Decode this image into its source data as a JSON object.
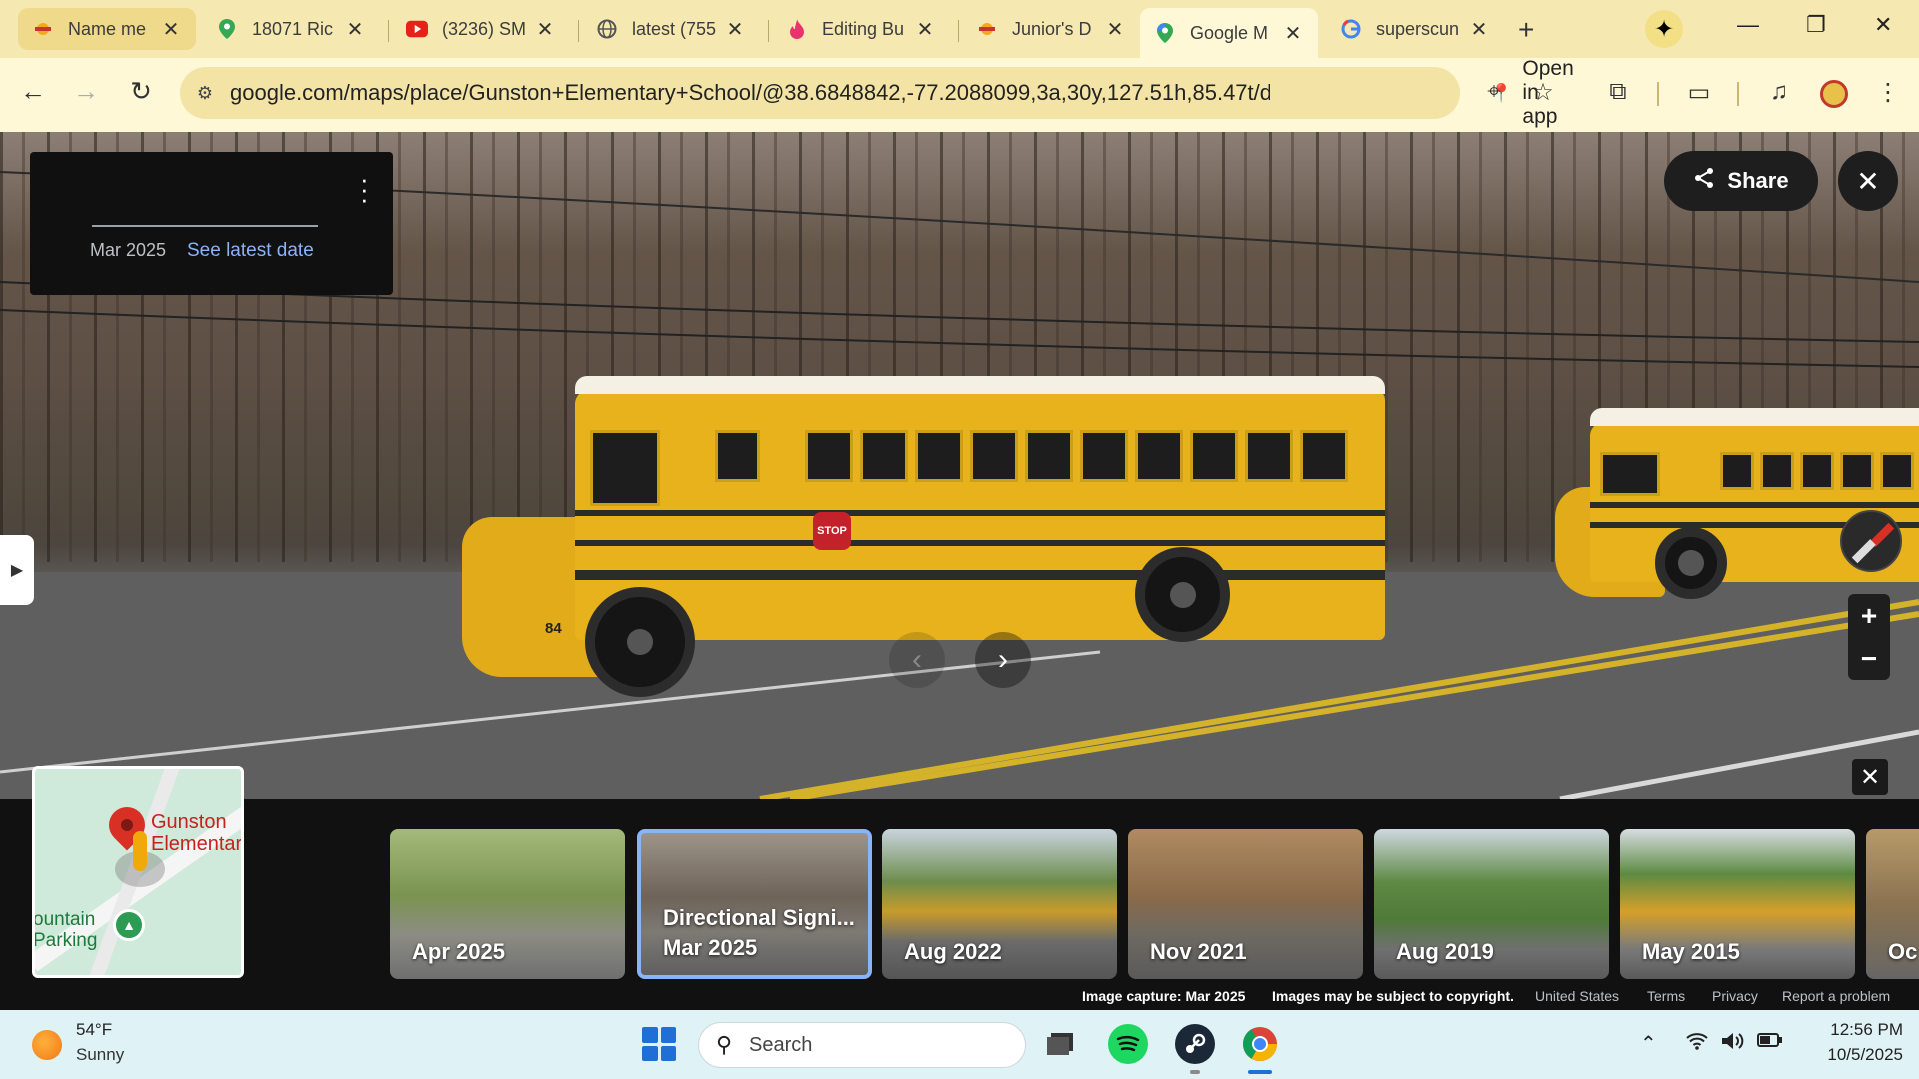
{
  "browser": {
    "tabs": [
      {
        "title": "Name me",
        "icon": "sun-fire-icon"
      },
      {
        "title": "18071 Ric",
        "icon": "maps-pin-icon"
      },
      {
        "title": "(3236) SM",
        "icon": "youtube-icon"
      },
      {
        "title": "latest (755",
        "icon": "globe-icon"
      },
      {
        "title": "Editing Bu",
        "icon": "flame-icon"
      },
      {
        "title": "Junior's D",
        "icon": "sun-fire-icon"
      },
      {
        "title": "Google M",
        "icon": "maps-pin-icon"
      },
      {
        "title": "superscun",
        "icon": "google-icon"
      }
    ],
    "url": "google.com/maps/place/Gunston+Elementary+School/@38.6848842,-77.2088099,3a,30y,127.51h,85.47t/data=...",
    "open_in_app": "Open in app"
  },
  "streetview": {
    "date": "Mar 2025",
    "see_latest": "See latest date",
    "share": "Share",
    "bus_stop_sign": "STOP",
    "bus_number": "84"
  },
  "minimap": {
    "place": "Gunston Elementar",
    "place_line1": "Gunston",
    "place_line2": "Elementar",
    "park_line1": "ountain",
    "park_line2": "Parking"
  },
  "timeline": [
    {
      "line1": "Apr 2025",
      "line2": ""
    },
    {
      "line1": "Directional Signi...",
      "line2": "Mar 2025"
    },
    {
      "line1": "Aug 2022",
      "line2": ""
    },
    {
      "line1": "Nov 2021",
      "line2": ""
    },
    {
      "line1": "Aug 2019",
      "line2": ""
    },
    {
      "line1": "May 2015",
      "line2": ""
    },
    {
      "line1": "Oc",
      "line2": ""
    }
  ],
  "footer": {
    "capture": "Image capture: Mar 2025",
    "copyright": "Images may be subject to copyright.",
    "country": "United States",
    "terms": "Terms",
    "privacy": "Privacy",
    "report": "Report a problem"
  },
  "taskbar": {
    "temp": "54°F",
    "condition": "Sunny",
    "search_placeholder": "Search",
    "time": "12:56 PM",
    "date": "10/5/2025"
  },
  "colors": {
    "tabbar": "#f6e8b1",
    "toolbar": "#fff8d6",
    "accent_link": "#8ab4f8",
    "bus_yellow": "#e7b21c",
    "taskbar": "#dff2f6"
  }
}
